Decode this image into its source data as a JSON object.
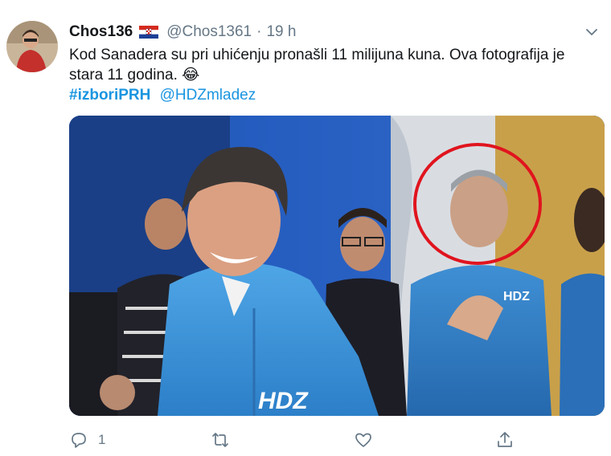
{
  "tweet": {
    "display_name": "Chos136",
    "handle": "@Chos1361",
    "separator": "·",
    "time": "19 h",
    "text": "Kod Sanadera su pri uhićenju pronašli 11 milijuna kuna. Ova fotografija je stara 11 godina. 😂",
    "hashtag": "#izboriPRH",
    "mention": "@HDZmladez",
    "photo_logo": "HDZ",
    "photo_jacket_logo": "HDZ"
  },
  "actions": {
    "reply_count": "1",
    "retweet_count": "",
    "like_count": ""
  },
  "icons": {
    "flag": "croatia-flag-icon",
    "menu": "chevron-down-icon",
    "reply": "reply-icon",
    "retweet": "retweet-icon",
    "like": "heart-icon",
    "share": "share-icon"
  },
  "colors": {
    "link": "#1b95e0",
    "secondary_text": "#657786",
    "primary_text": "#14171a"
  }
}
